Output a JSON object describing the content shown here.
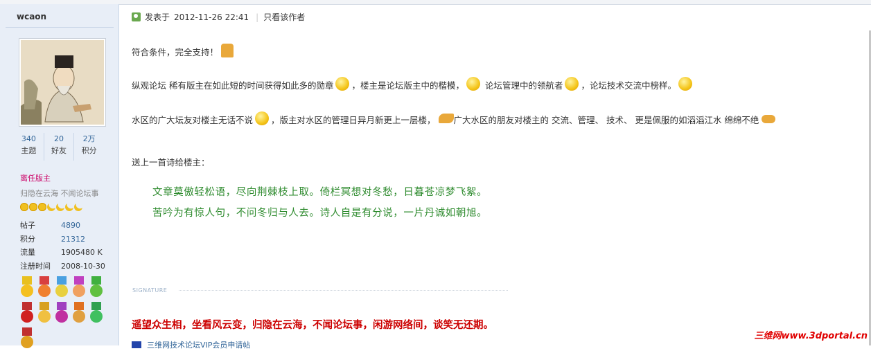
{
  "author": {
    "name": "wcaon",
    "stats": [
      {
        "value": "340",
        "label": "主题"
      },
      {
        "value": "20",
        "label": "好友"
      },
      {
        "value": "2万",
        "label": "积分"
      }
    ],
    "rank": "离任版主",
    "custom_title": "归隐在云海  不闻论坛事",
    "level_icons": [
      "sun",
      "sun",
      "sun",
      "moon",
      "moon",
      "moon",
      "moon"
    ],
    "info": [
      {
        "key": "帖子",
        "value": "4890"
      },
      {
        "key": "积分",
        "value": "21312"
      },
      {
        "key": "流量",
        "value": "1905480 K"
      },
      {
        "key": "注册时间",
        "value": "2008-10-30"
      }
    ],
    "medals": [
      {
        "name": "medal-1",
        "ribbon": "#e8c020",
        "disc": "#f4c020"
      },
      {
        "name": "medal-2",
        "ribbon": "#d84040",
        "disc": "#f08030"
      },
      {
        "name": "medal-3",
        "ribbon": "#4aa0e0",
        "disc": "#e8d040"
      },
      {
        "name": "medal-4",
        "ribbon": "#c040c0",
        "disc": "#f0a060"
      },
      {
        "name": "medal-5",
        "ribbon": "#40b040",
        "disc": "#60c040"
      },
      {
        "name": "medal-6",
        "ribbon": "#c03030",
        "disc": "#d02020"
      },
      {
        "name": "medal-7",
        "ribbon": "#d8a020",
        "disc": "#f0c040"
      },
      {
        "name": "medal-8",
        "ribbon": "#a040c0",
        "disc": "#c030a0"
      },
      {
        "name": "medal-9",
        "ribbon": "#e07020",
        "disc": "#e0a040"
      },
      {
        "name": "medal-10",
        "ribbon": "#30a050",
        "disc": "#40c060"
      },
      {
        "name": "medal-11",
        "ribbon": "#c03030",
        "disc": "#e0a020"
      }
    ]
  },
  "post": {
    "posted_label": "发表于",
    "posted_time": "2012-11-26 22:41",
    "only_author": "只看该作者",
    "line1": "符合条件，完全支持！",
    "line2_a": "纵观论坛 稀有版主在如此短的时间获得如此多的勋章",
    "line2_b": "，楼主是论坛版主中的楷模，",
    "line2_c": " 论坛管理中的领航者",
    "line2_d": "，论坛技术交流中榜样。",
    "line3_a": "水区的广大坛友对楼主无话不说",
    "line3_b": "，版主对水区的管理日异月新更上一层楼，",
    "line3_c": "广大水区的朋友对楼主的 交流、管理、 技术、 更是佩服的如滔滔江水 绵绵不绝",
    "line4": "送上一首诗给楼主：",
    "poem1": "文章莫傲轻松语，尽向荆棘枝上取。倚栏冥想对冬愁，日暮苍凉梦飞絮。",
    "poem2": "苦吟为有惊人句，不问冬归与人去。诗人自是有分说，一片丹诚如朝旭。"
  },
  "signature_label": "SIGNATURE",
  "signature": "遥望众生相，坐看风云变，归隐在云海，不闻论坛事，闲游网络间，谈笑无还期。",
  "cutoff_text": "三维网技术论坛VIP会员申请帖",
  "watermark": "三维网www.3dportal.cn"
}
